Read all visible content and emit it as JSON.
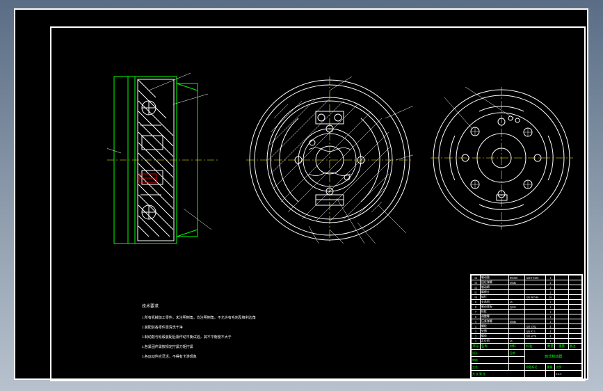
{
  "domain": "Diagram",
  "drawing": {
    "type": "CAD Mechanical Drawing",
    "subject": "Drum Brake Assembly",
    "views": [
      "Section View (Side)",
      "Front View (Internal)",
      "Rear View (Back Plate)"
    ],
    "colors": {
      "outline": "#ffffff",
      "highlight": "#00ff00",
      "accent": "#ff0000",
      "center": "#ffff00"
    }
  },
  "notes": {
    "title": "技术要求",
    "lines": [
      "1.所有机械加工零件，未注明倒角，均注明倒角，不允许有毛刺及锋利边角",
      "2.装配前各零件需清洗干净",
      "3.制动鼓与轮毂装配后需作动平衡试验，其不平衡度不大于",
      "4.各紧固件需按规定拧紧力矩拧紧",
      "5.各运动件应灵活，不得有卡滞现象"
    ]
  },
  "parts_list": {
    "headers": [
      "序号",
      "名称",
      "材料",
      "标准",
      "数量",
      "重量",
      "备注"
    ],
    "rows": [
      {
        "no": "14",
        "name": "制动鼓",
        "mat": "HT200",
        "std": "GB/T 9439",
        "qty": "1",
        "wt": "",
        "note": ""
      },
      {
        "no": "13",
        "name": "回位弹簧",
        "mat": "65Mn",
        "std": "",
        "qty": "2",
        "wt": "",
        "note": ""
      },
      {
        "no": "12",
        "name": "制动蹄",
        "mat": "",
        "std": "",
        "qty": "2",
        "wt": "",
        "note": ""
      },
      {
        "no": "11",
        "name": "摩擦片",
        "mat": "",
        "std": "",
        "qty": "2",
        "wt": "",
        "note": ""
      },
      {
        "no": "10",
        "name": "铆钉",
        "mat": "",
        "std": "GB 867-86",
        "qty": "16",
        "wt": "",
        "note": ""
      },
      {
        "no": "9",
        "name": "支承销",
        "mat": "45",
        "std": "",
        "qty": "2",
        "wt": "",
        "note": ""
      },
      {
        "no": "8",
        "name": "制动底板",
        "mat": "Q235",
        "std": "",
        "qty": "1",
        "wt": "",
        "note": ""
      },
      {
        "no": "7",
        "name": "轮缸",
        "mat": "",
        "std": "",
        "qty": "1",
        "wt": "",
        "note": ""
      },
      {
        "no": "6",
        "name": "调整臂",
        "mat": "",
        "std": "",
        "qty": "1",
        "wt": "",
        "note": ""
      },
      {
        "no": "5",
        "name": "压紧弹簧",
        "mat": "65Mn",
        "std": "",
        "qty": "2",
        "wt": "",
        "note": ""
      },
      {
        "no": "4",
        "name": "螺栓",
        "mat": "",
        "std": "GB 5782",
        "qty": "4",
        "wt": "",
        "note": ""
      },
      {
        "no": "3",
        "name": "垫圈",
        "mat": "",
        "std": "GB 97.1",
        "qty": "4",
        "wt": "",
        "note": ""
      },
      {
        "no": "2",
        "name": "螺母",
        "mat": "",
        "std": "GB 6170",
        "qty": "4",
        "wt": "",
        "note": ""
      },
      {
        "no": "1",
        "name": "定位销",
        "mat": "45",
        "std": "",
        "qty": "2",
        "wt": "",
        "note": ""
      }
    ]
  },
  "title_block": {
    "drawn": "设计",
    "checked": "审核",
    "approved": "工艺",
    "date": "日期",
    "drawing_name": "鼓式制动器",
    "drawing_number": "",
    "material_label": "材料",
    "scale_label": "比例",
    "scale_value": "1:2.5",
    "sheet_label": "共 张 第 张",
    "weight_label": "重量",
    "stage_label": "阶段标记",
    "org": ""
  }
}
